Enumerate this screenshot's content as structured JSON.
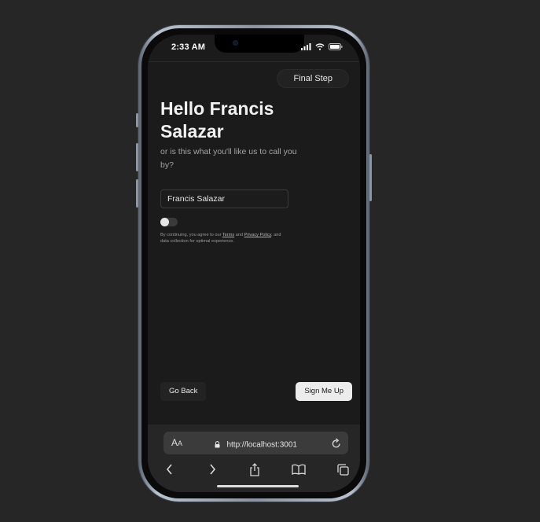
{
  "status_bar": {
    "time": "2:33 AM"
  },
  "header": {
    "step_label": "Final Step"
  },
  "greeting": {
    "title": "Hello Francis Salazar",
    "subtitle": "or is this what you'll like us to call you by?"
  },
  "name_field": {
    "value": "Francis Salazar"
  },
  "consent": {
    "prefix": "By continuing, you agree to our",
    "terms_link": "Terms",
    "and": "and",
    "privacy_link": "Privacy Policy",
    "suffix": ", and data collection for optimal experience.",
    "toggle_on": false
  },
  "actions": {
    "back_label": "Go Back",
    "submit_label": "Sign Me Up"
  },
  "browser": {
    "aa_label": "AA",
    "url": "http://localhost:3001"
  },
  "icons": [
    "signal-icon",
    "wifi-icon",
    "battery-icon",
    "lock-icon",
    "reload-icon",
    "back-arrow-icon",
    "forward-arrow-icon",
    "share-icon",
    "bookmarks-icon",
    "tabs-icon"
  ]
}
